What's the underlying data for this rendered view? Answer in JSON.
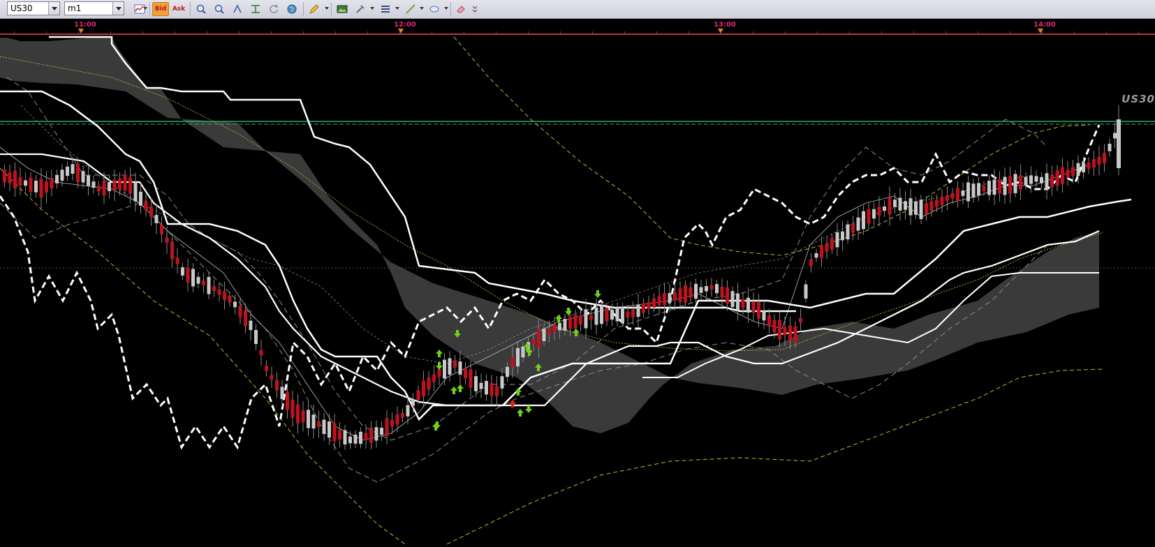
{
  "toolbar": {
    "symbol": "US30",
    "timeframe": "m1",
    "bid_label": "Bid",
    "ask_label": "Ask",
    "icons": [
      "chart-type-icon",
      "bid-icon",
      "ask-icon",
      "zoom-in-icon",
      "zoom-out-icon",
      "autoscroll-icon",
      "period-separator-icon",
      "refresh-icon",
      "globe-icon",
      "pencil-icon",
      "screenshot-icon",
      "tools-icon",
      "lines-icon",
      "trendline-icon",
      "ellipse-icon",
      "eraser-icon",
      "more-icon"
    ]
  },
  "timescale": {
    "labels": [
      "11:00",
      "12:00",
      "13:00",
      "14:00"
    ]
  },
  "chart": {
    "symbol_watermark": "US30",
    "colors": {
      "background": "#000000",
      "bull_candle": "#c8c8c8",
      "bear_candle": "#c0121e",
      "cloud": "#3a3a3a",
      "kijun_tenkan": "#ffffff",
      "bands": "#8c8c8c",
      "yellow_ma": "#c8b43a",
      "level_line": "#2fa86a",
      "buy_arrow": "#6fd21a",
      "sell_arrow": "#e02020"
    }
  }
}
